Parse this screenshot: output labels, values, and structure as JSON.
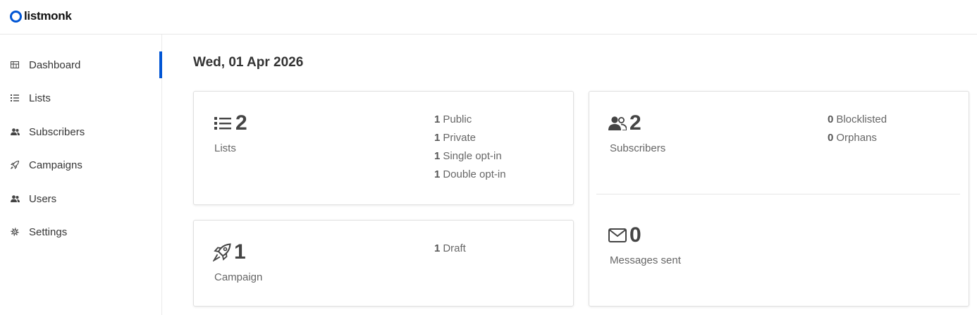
{
  "app": {
    "name": "listmonk"
  },
  "sidebar": {
    "items": [
      {
        "label": "Dashboard",
        "icon": "dashboard-icon",
        "active": true
      },
      {
        "label": "Lists",
        "icon": "list-icon"
      },
      {
        "label": "Subscribers",
        "icon": "users-icon"
      },
      {
        "label": "Campaigns",
        "icon": "rocket-icon"
      },
      {
        "label": "Users",
        "icon": "users-icon"
      },
      {
        "label": "Settings",
        "icon": "gear-icon"
      }
    ]
  },
  "main": {
    "date": "Wed, 01 Apr 2026",
    "lists": {
      "count": "2",
      "label": "Lists",
      "icon": "list-icon",
      "breakdown": [
        {
          "value": "1",
          "label": "Public"
        },
        {
          "value": "1",
          "label": "Private"
        },
        {
          "value": "1",
          "label": "Single opt-in"
        },
        {
          "value": "1",
          "label": "Double opt-in"
        }
      ]
    },
    "campaigns": {
      "count": "1",
      "label": "Campaign",
      "icon": "rocket-icon",
      "breakdown": [
        {
          "value": "1",
          "label": "Draft"
        }
      ]
    },
    "subscribers": {
      "count": "2",
      "label": "Subscribers",
      "icon": "users-icon",
      "breakdown": [
        {
          "value": "0",
          "label": "Blocklisted"
        },
        {
          "value": "0",
          "label": "Orphans"
        }
      ]
    },
    "messages": {
      "count": "0",
      "label": "Messages sent",
      "icon": "envelope-icon"
    }
  },
  "colors": {
    "accent": "#0055d4",
    "text": "#333333",
    "muted": "#666666"
  }
}
